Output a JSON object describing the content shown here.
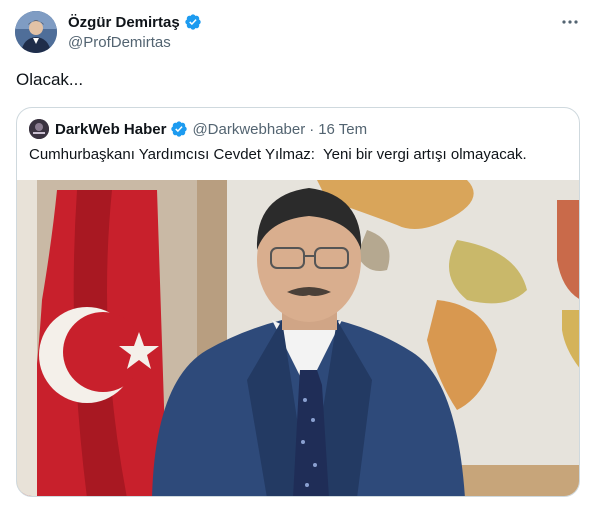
{
  "tweet": {
    "author": {
      "name": "Özgür Demirtaş",
      "handle": "@ProfDemirtas",
      "verified": true,
      "avatar_icon": "profile-photo"
    },
    "text": "Olacak...",
    "more_icon": "more-dots-icon",
    "quoted": {
      "name": "DarkWeb Haber",
      "handle": "@Darkwebhaber",
      "separator": "·",
      "date": "16 Tem",
      "verified": true,
      "text": "Cumhurbaşkanı Yardımcısı Cevdet Yılmaz:  Yeni bir vergi artışı olmayacak.",
      "image": "photo-of-man-in-suit-with-turkish-flag-and-world-map"
    }
  },
  "colors": {
    "verified_badge": "#1d9bf0",
    "secondary_text": "#536471",
    "border": "#cfd9de",
    "primary_text": "#0f1419"
  }
}
